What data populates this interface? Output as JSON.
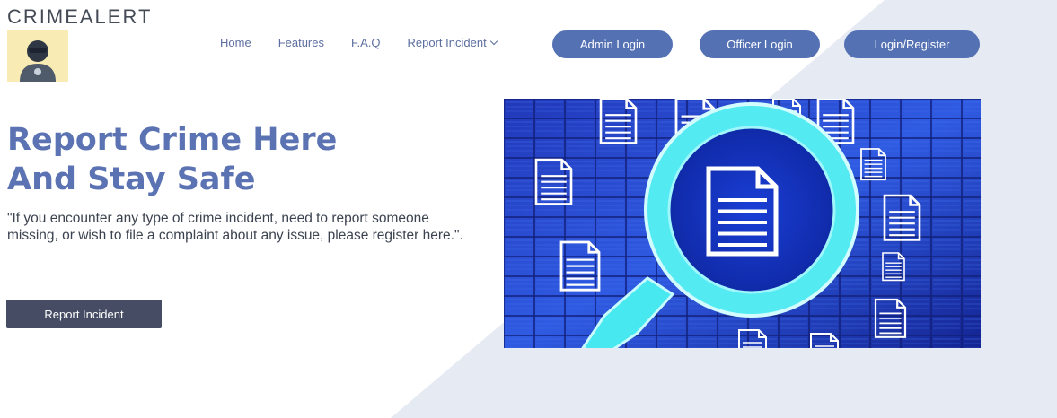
{
  "brand": {
    "name": "CRIMEALERT"
  },
  "nav": {
    "items": [
      {
        "label": "Home"
      },
      {
        "label": "Features"
      },
      {
        "label": "F.A.Q"
      },
      {
        "label": "Report Incident"
      }
    ]
  },
  "buttons": {
    "admin_login": "Admin Login",
    "officer_login": "Officer Login",
    "login_register": "Login/Register"
  },
  "hero": {
    "title_line1": "Report Crime Here",
    "title_line2": "And Stay Safe",
    "quote": "\"If you encounter any type of crime incident, need to report someone missing, or wish to file a complaint about any issue, please register here.\".",
    "cta_label": "Report Incident"
  },
  "icons": {
    "logo": "hacker-avatar-icon",
    "dropdown": "chevron-down-icon",
    "hero_image": "magnifier-documents-image"
  },
  "colors": {
    "accent": "#5471b4",
    "title": "#5b73b3",
    "cta": "#454c63",
    "background_shape": "#e6eaf3",
    "logo_bg": "#f8ecb4"
  }
}
